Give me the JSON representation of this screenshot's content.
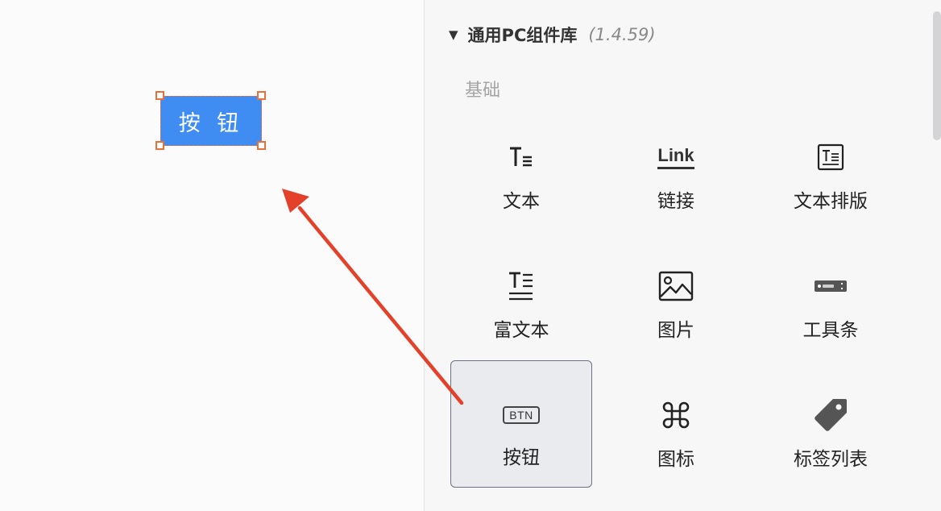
{
  "canvas": {
    "button_label": "按 钮"
  },
  "library": {
    "title": "通用PC组件库",
    "version": "(1.4.59)",
    "section": "基础",
    "items": [
      {
        "label": "文本",
        "icon": "text-icon"
      },
      {
        "label": "链接",
        "icon": "link-icon",
        "icon_text": "Link"
      },
      {
        "label": "文本排版",
        "icon": "text-layout-icon"
      },
      {
        "label": "富文本",
        "icon": "rich-text-icon"
      },
      {
        "label": "图片",
        "icon": "image-icon"
      },
      {
        "label": "工具条",
        "icon": "toolbar-icon"
      },
      {
        "label": "按钮",
        "icon": "button-icon",
        "icon_text": "BTN",
        "selected": true
      },
      {
        "label": "图标",
        "icon": "command-icon"
      },
      {
        "label": "标签列表",
        "icon": "tag-icon"
      }
    ]
  },
  "colors": {
    "button_blue": "#3f8cf3",
    "selection_orange": "#e8703a",
    "arrow_red": "#e4412b",
    "selected_border": "#6c7285"
  }
}
